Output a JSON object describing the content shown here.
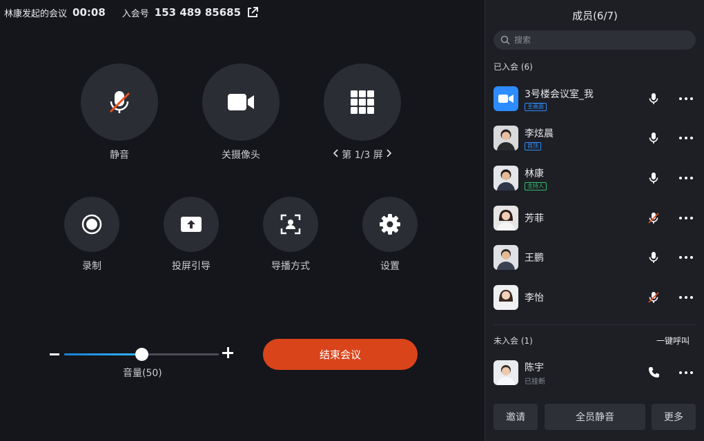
{
  "topbar": {
    "host_meeting": "林康发起的会议",
    "timer": "00:08",
    "meeting_id_label": "入会号",
    "meeting_id": "153 489 85685"
  },
  "controls": {
    "mute": "静音",
    "camera_off": "关摄像头",
    "page_prefix": "第 1/3 屏",
    "record": "录制",
    "screen_guide": "投屏引导",
    "director_mode": "导播方式",
    "settings": "设置"
  },
  "volume": {
    "label": "音量(50)",
    "level": 50
  },
  "end_meeting": "结束会议",
  "panel": {
    "title": "成员(6/7)",
    "search_placeholder": "搜索",
    "joined_title": "已入会 (6)",
    "not_joined_title": "未入会 (1)",
    "call_all": "一键呼叫",
    "invite": "邀请",
    "mute_all": "全员静音",
    "more": "更多"
  },
  "members": [
    {
      "name": "3号楼会议室_我",
      "tag": "主画面",
      "tag_color": "blue",
      "mic": "on",
      "avatar": "zoom"
    },
    {
      "name": "李炫晨",
      "tag": "首顶",
      "tag_color": "blue",
      "mic": "on",
      "avatar": "person1"
    },
    {
      "name": "林康",
      "tag": "主持人",
      "tag_color": "green",
      "mic": "on",
      "avatar": "person2"
    },
    {
      "name": "芳菲",
      "tag": "",
      "tag_color": "",
      "mic": "off",
      "avatar": "person3"
    },
    {
      "name": "王鹏",
      "tag": "",
      "tag_color": "",
      "mic": "on",
      "avatar": "person4"
    },
    {
      "name": "李怡",
      "tag": "",
      "tag_color": "",
      "mic": "off",
      "avatar": "person5"
    }
  ],
  "not_joined": [
    {
      "name": "陈宇",
      "status": "已挂断",
      "avatar": "person6"
    }
  ],
  "colors": {
    "end_button": "#d9441b",
    "accent_blue": "#2f8dff",
    "host_green": "#2fc26a"
  }
}
